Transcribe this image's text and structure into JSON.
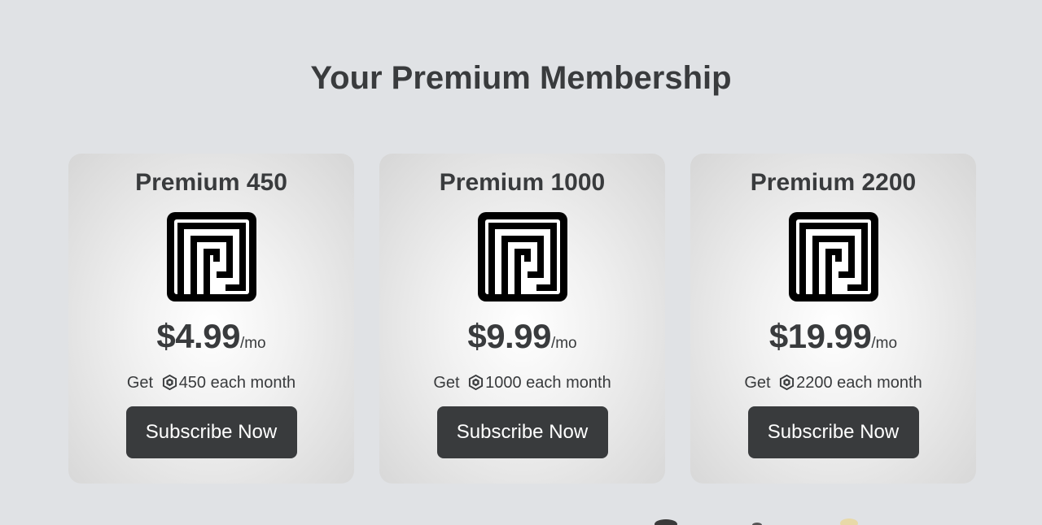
{
  "page": {
    "title": "Your Premium Membership"
  },
  "plans": [
    {
      "name": "Premium 450",
      "price": "$4.99",
      "period": "/mo",
      "get_prefix": "Get",
      "get_suffix": "450 each month",
      "button": "Subscribe Now",
      "icon": "premium-logo-icon"
    },
    {
      "name": "Premium 1000",
      "price": "$9.99",
      "period": "/mo",
      "get_prefix": "Get",
      "get_suffix": "1000 each month",
      "button": "Subscribe Now",
      "icon": "premium-logo-icon"
    },
    {
      "name": "Premium 2200",
      "price": "$19.99",
      "period": "/mo",
      "get_prefix": "Get",
      "get_suffix": "2200 each month",
      "button": "Subscribe Now",
      "icon": "premium-logo-icon"
    }
  ],
  "colors": {
    "background": "#e0e2e5",
    "text": "#393b3d",
    "button": "#393b3d",
    "button_text": "#ffffff"
  }
}
